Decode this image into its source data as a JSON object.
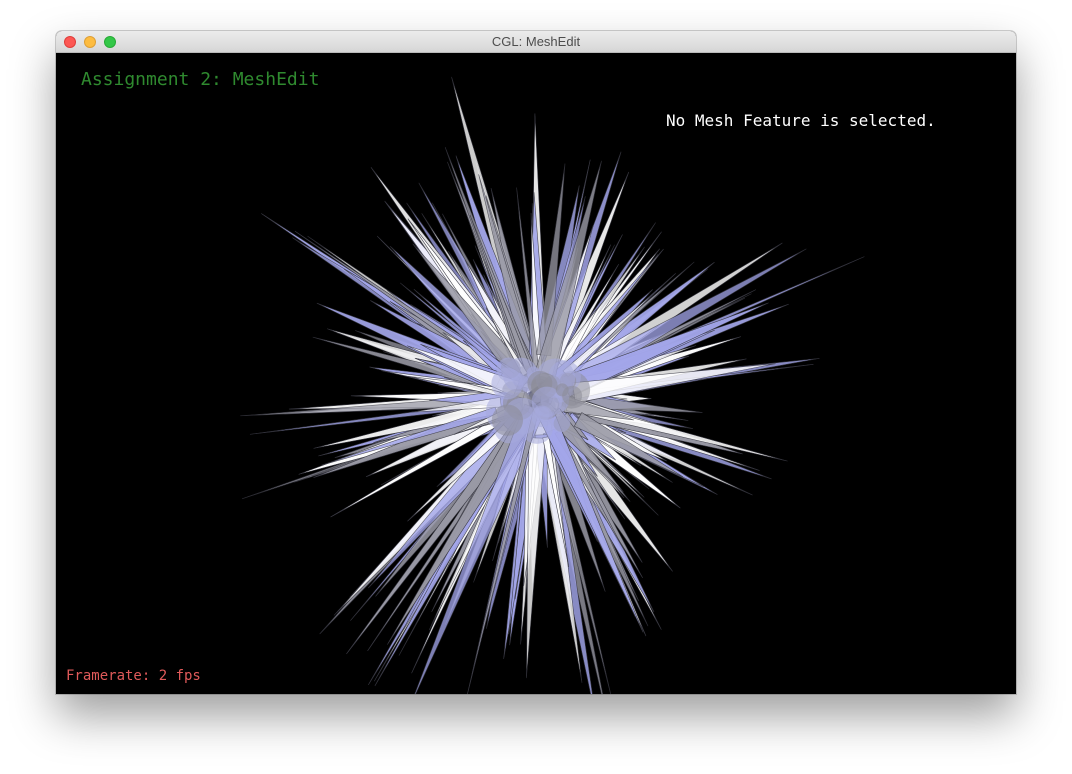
{
  "window": {
    "title": "CGL: MeshEdit"
  },
  "overlay": {
    "assignment_title": "Assignment 2: MeshEdit",
    "selection_status": "No Mesh Feature is selected.",
    "framerate": "Framerate: 2 fps"
  },
  "colors": {
    "background": "#000000",
    "assignment_title": "#2f8a2f",
    "selection_status": "#ffffff",
    "framerate": "#e05a5a",
    "mesh_light": "#ffffff",
    "mesh_gray": "#9a9aa6",
    "mesh_blue": "#a3a6ea"
  },
  "icons": [
    "close-icon",
    "minimize-icon",
    "zoom-icon"
  ]
}
